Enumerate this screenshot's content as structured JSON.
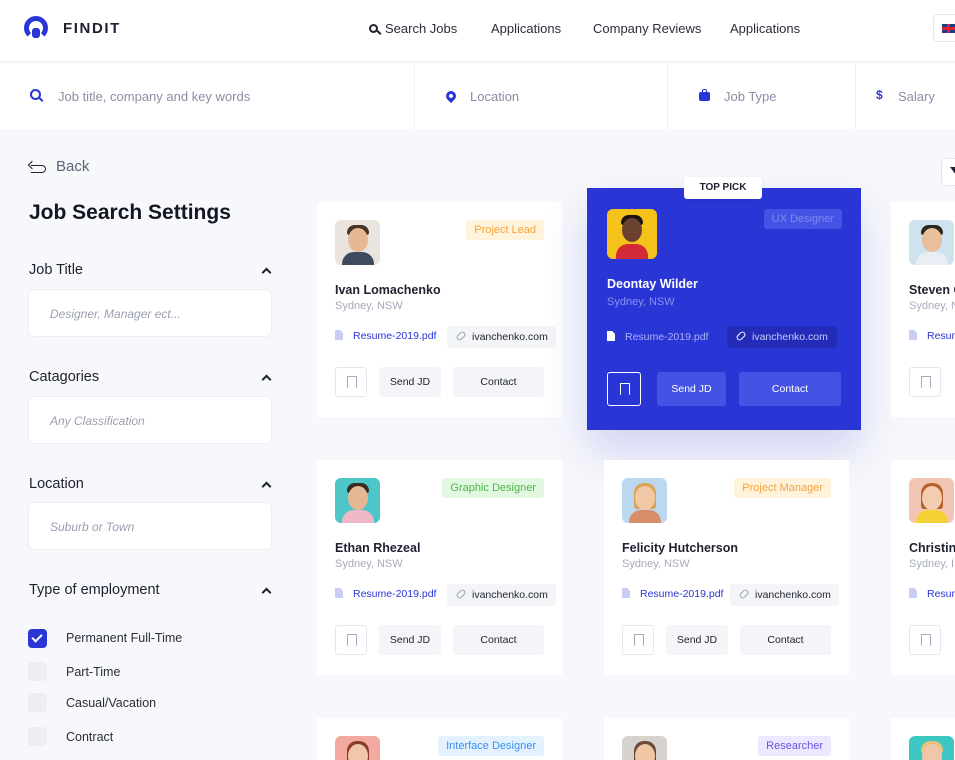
{
  "brand": {
    "name": "FINDIT",
    "accent": "#2a35d6"
  },
  "nav": {
    "items": [
      "Search Jobs",
      "Applications",
      "Company Reviews",
      "Applications"
    ]
  },
  "search": {
    "keywords_placeholder": "Job title, company and key words",
    "location_placeholder": "Location",
    "job_type_placeholder": "Job Type",
    "salary_placeholder": "Salary"
  },
  "sidebar": {
    "back_label": "Back",
    "title": "Job Search Settings",
    "job_title": {
      "label": "Job Title",
      "placeholder": "Designer, Manager ect..."
    },
    "categories": {
      "label": "Catagories",
      "placeholder": "Any Classification"
    },
    "location": {
      "label": "Location",
      "placeholder": "Suburb or Town"
    },
    "employment": {
      "label": "Type of employment",
      "options": [
        {
          "label": "Permanent Full-Time",
          "checked": true
        },
        {
          "label": "Part-Time",
          "checked": false
        },
        {
          "label": "Casual/Vacation",
          "checked": false
        },
        {
          "label": "Contract",
          "checked": false
        }
      ]
    }
  },
  "top_pick_label": "TOP PICK",
  "cards": [
    {
      "name": "Ivan Lomachenko",
      "location": "Sydney, NSW",
      "tag": "Project Lead",
      "tag_bg": "#fff3dc",
      "tag_color": "#f0a640",
      "resume": "Resume-2019.pdf",
      "link": "ivanchenko.com",
      "send": "Send JD",
      "contact": "Contact"
    },
    {
      "name": "Deontay Wilder",
      "location": "Sydney, NSW",
      "tag": "UX Designer",
      "resume": "Resume-2019.pdf",
      "link": "ivanchenko.com",
      "send": "Send JD",
      "contact": "Contact",
      "featured": true
    },
    {
      "name": "Steven C",
      "location": "Sydney, N",
      "resume": "Resum"
    },
    {
      "name": "Ethan Rhezeal",
      "location": "Sydney, NSW",
      "tag": "Graphic Designer",
      "tag_bg": "#e3f8e0",
      "tag_color": "#49b749",
      "resume": "Resume-2019.pdf",
      "link": "ivanchenko.com",
      "send": "Send JD",
      "contact": "Contact"
    },
    {
      "name": "Felicity Hutcherson",
      "location": "Sydney, NSW",
      "tag": "Project Manager",
      "tag_bg": "#fff3dc",
      "tag_color": "#f0a640",
      "resume": "Resume-2019.pdf",
      "link": "ivanchenko.com",
      "send": "Send JD",
      "contact": "Contact"
    },
    {
      "name": "Christin",
      "location": "Sydney, I",
      "resume": "Resum"
    },
    {
      "tag": "Interface Designer",
      "tag_bg": "#e4f1ff",
      "tag_color": "#3d8ef0"
    },
    {
      "tag": "Researcher",
      "tag_bg": "#ece8ff",
      "tag_color": "#6a55e3"
    }
  ]
}
